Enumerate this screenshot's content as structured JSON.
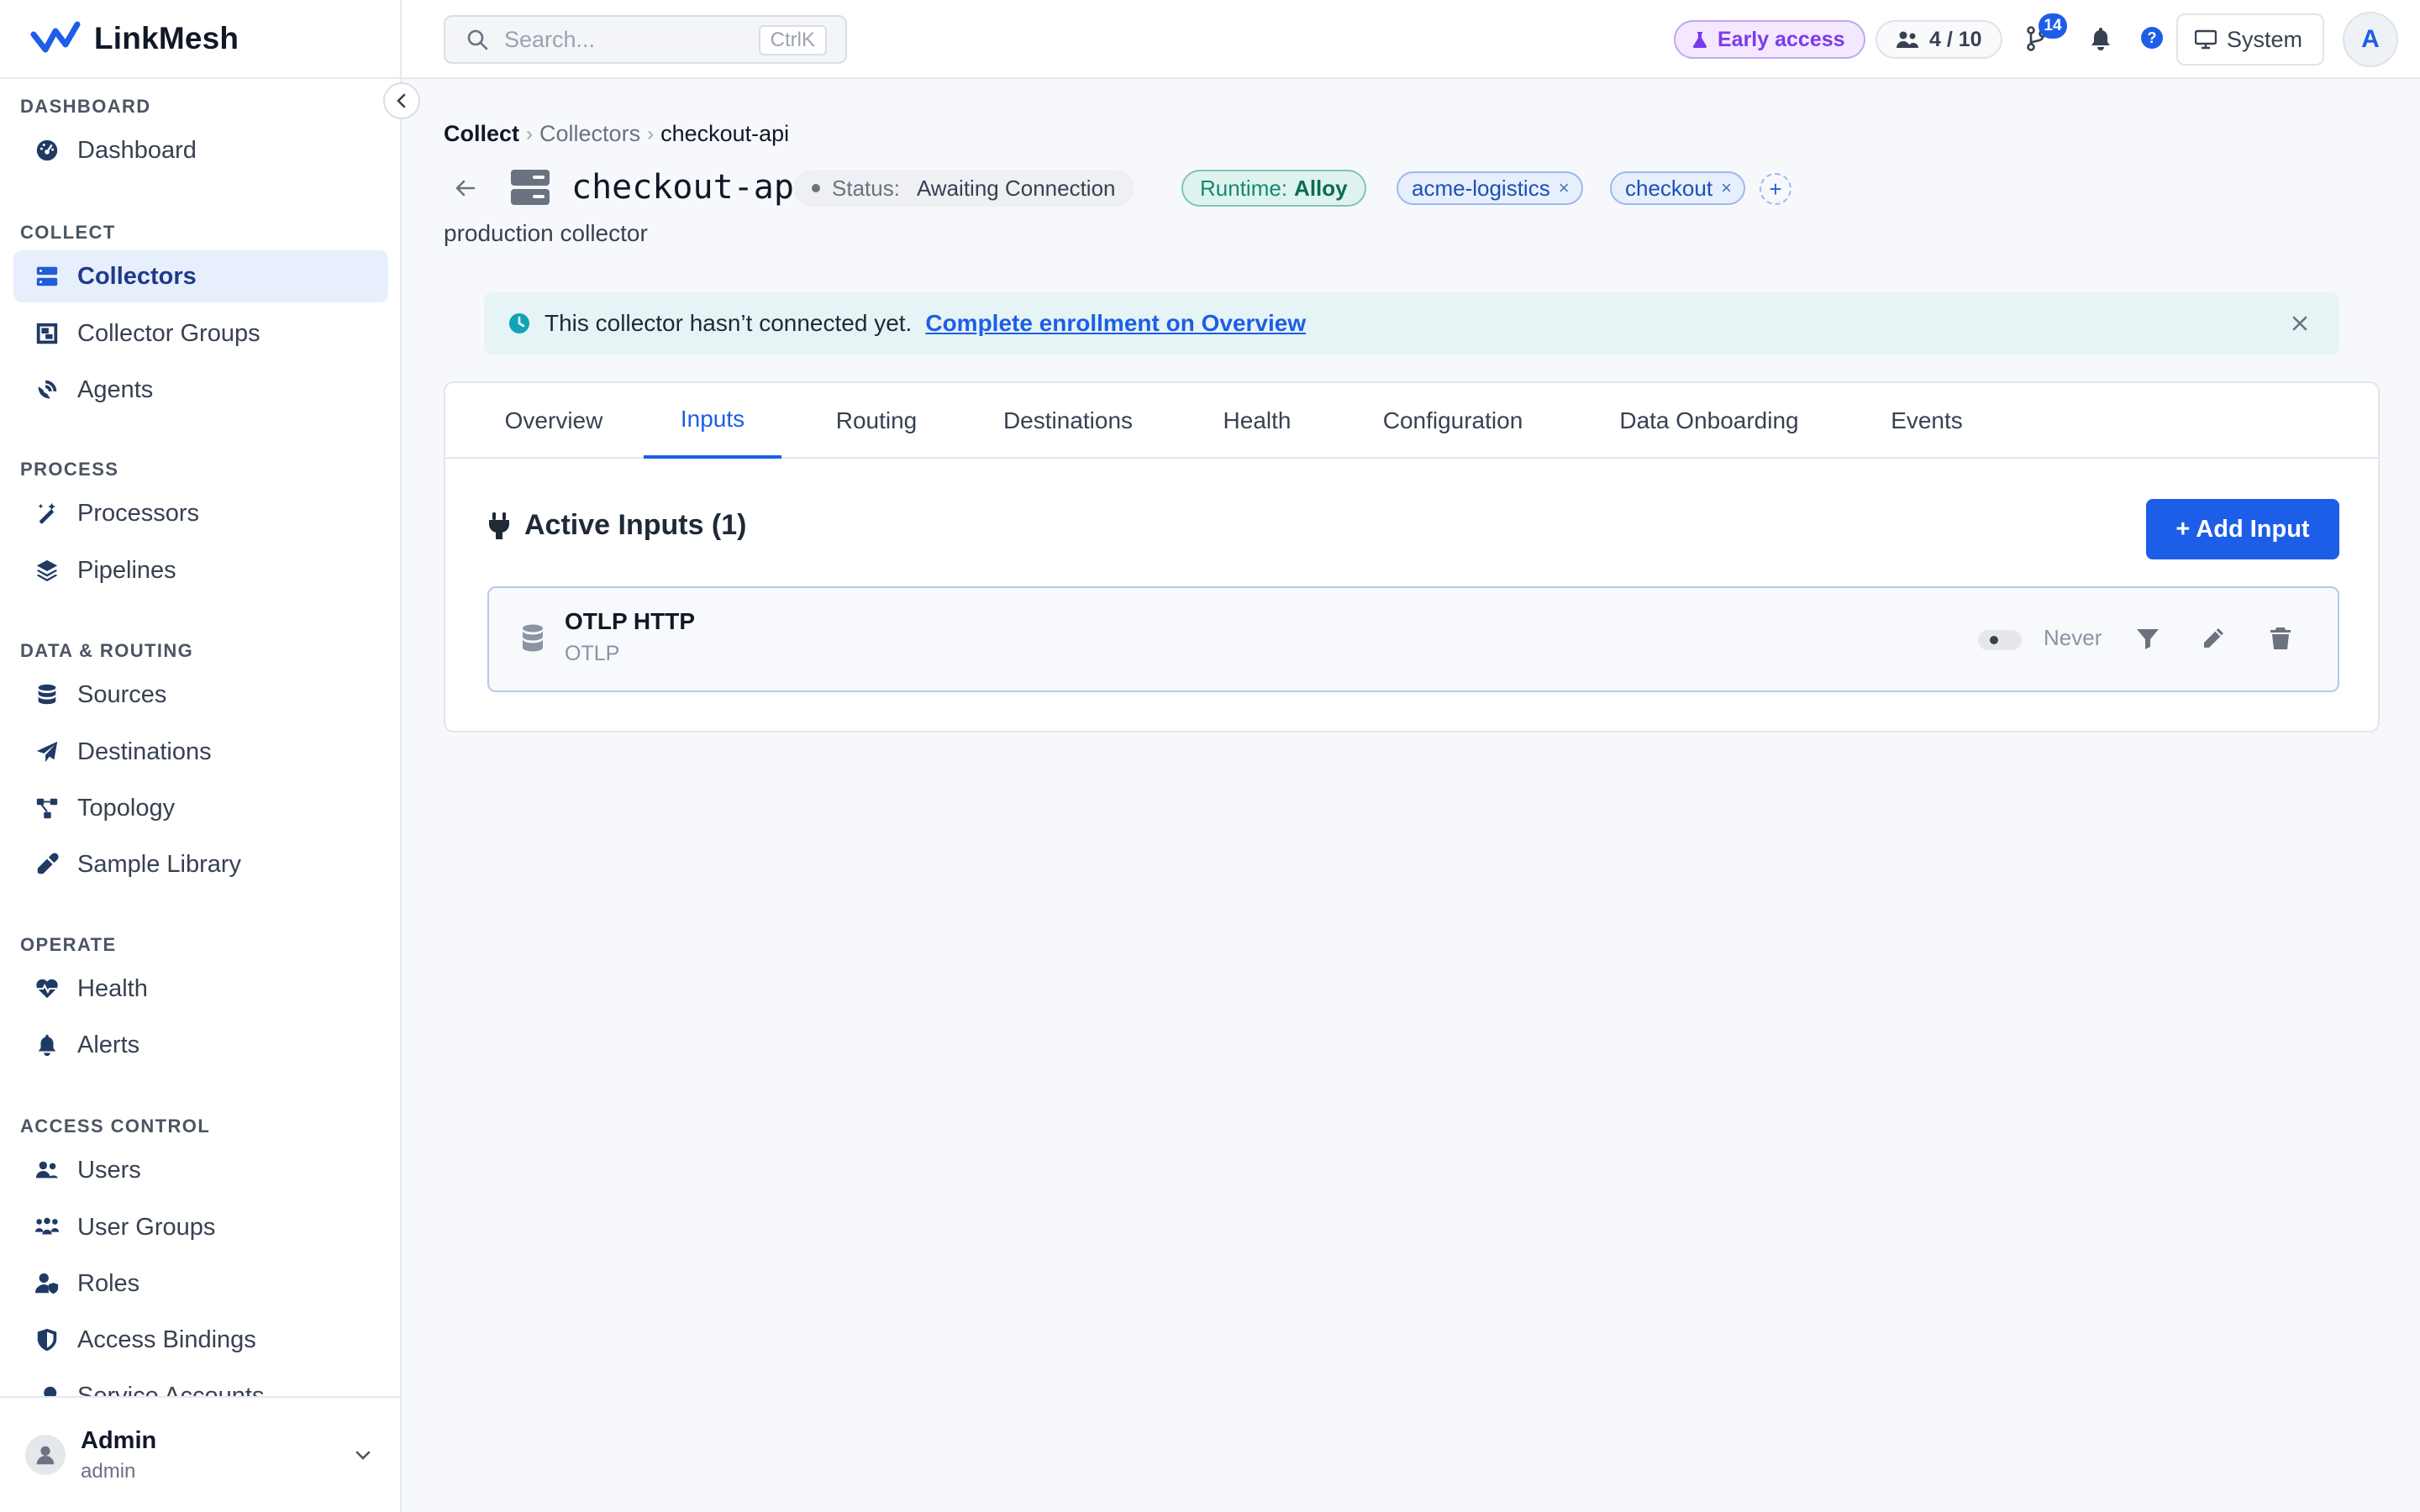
{
  "app": {
    "name": "LinkMesh"
  },
  "sidebar": {
    "sections": [
      {
        "title": "DASHBOARD",
        "items": [
          {
            "label": "Dashboard",
            "icon": "gauge-icon"
          }
        ]
      },
      {
        "title": "COLLECT",
        "items": [
          {
            "label": "Collectors",
            "icon": "server-icon",
            "active": true
          },
          {
            "label": "Collector Groups",
            "icon": "object-group-icon"
          },
          {
            "label": "Agents",
            "icon": "satellite-dish-icon"
          }
        ]
      },
      {
        "title": "PROCESS",
        "items": [
          {
            "label": "Processors",
            "icon": "wand-icon"
          },
          {
            "label": "Pipelines",
            "icon": "layers-icon"
          }
        ]
      },
      {
        "title": "DATA & ROUTING",
        "items": [
          {
            "label": "Sources",
            "icon": "database-icon"
          },
          {
            "label": "Destinations",
            "icon": "paper-plane-icon"
          },
          {
            "label": "Topology",
            "icon": "diagram-icon"
          },
          {
            "label": "Sample Library",
            "icon": "eyedropper-icon"
          }
        ]
      },
      {
        "title": "OPERATE",
        "items": [
          {
            "label": "Health",
            "icon": "heart-pulse-icon"
          },
          {
            "label": "Alerts",
            "icon": "bell-icon"
          }
        ]
      },
      {
        "title": "ACCESS CONTROL",
        "items": [
          {
            "label": "Users",
            "icon": "users-icon"
          },
          {
            "label": "User Groups",
            "icon": "people-group-icon"
          },
          {
            "label": "Roles",
            "icon": "user-shield-icon"
          },
          {
            "label": "Access Bindings",
            "icon": "shield-icon"
          },
          {
            "label": "Service Accounts",
            "icon": "key-icon"
          }
        ]
      }
    ],
    "user": {
      "name": "Admin",
      "role": "admin"
    }
  },
  "topbar": {
    "search_placeholder": "Search...",
    "search_shortcut": "CtrlK",
    "early_access": "Early access",
    "seats": "4 / 10",
    "git_badge": "14",
    "help": "?",
    "theme": "System",
    "avatar_initial": "A"
  },
  "breadcrumb": {
    "items": [
      "Collect",
      "Collectors",
      "checkout-api"
    ],
    "separator": "›"
  },
  "collector": {
    "name": "checkout-api",
    "status_label": "Status:",
    "status_value": "Awaiting Connection",
    "runtime_label": "Runtime:",
    "runtime_value": "Alloy",
    "tags": [
      "acme-logistics",
      "checkout"
    ],
    "tag_remove": "×",
    "tag_add": "+",
    "description": "production collector"
  },
  "alert": {
    "text": "This collector hasn’t connected yet.",
    "link": "Complete enrollment on Overview",
    "close": "×"
  },
  "tabs": [
    "Overview",
    "Inputs",
    "Routing",
    "Destinations",
    "Health",
    "Configuration",
    "Data Onboarding",
    "Events"
  ],
  "active_tab": "Inputs",
  "inputs_panel": {
    "title": "Active Inputs (1)",
    "add_button": "+ Add Input",
    "rows": [
      {
        "name": "OTLP HTTP",
        "type": "OTLP",
        "last_seen": "Never",
        "enabled": false
      }
    ]
  },
  "colors": {
    "accent": "#1d5ee8",
    "runtime": "#138a72",
    "early_access": "#7c3aed"
  }
}
